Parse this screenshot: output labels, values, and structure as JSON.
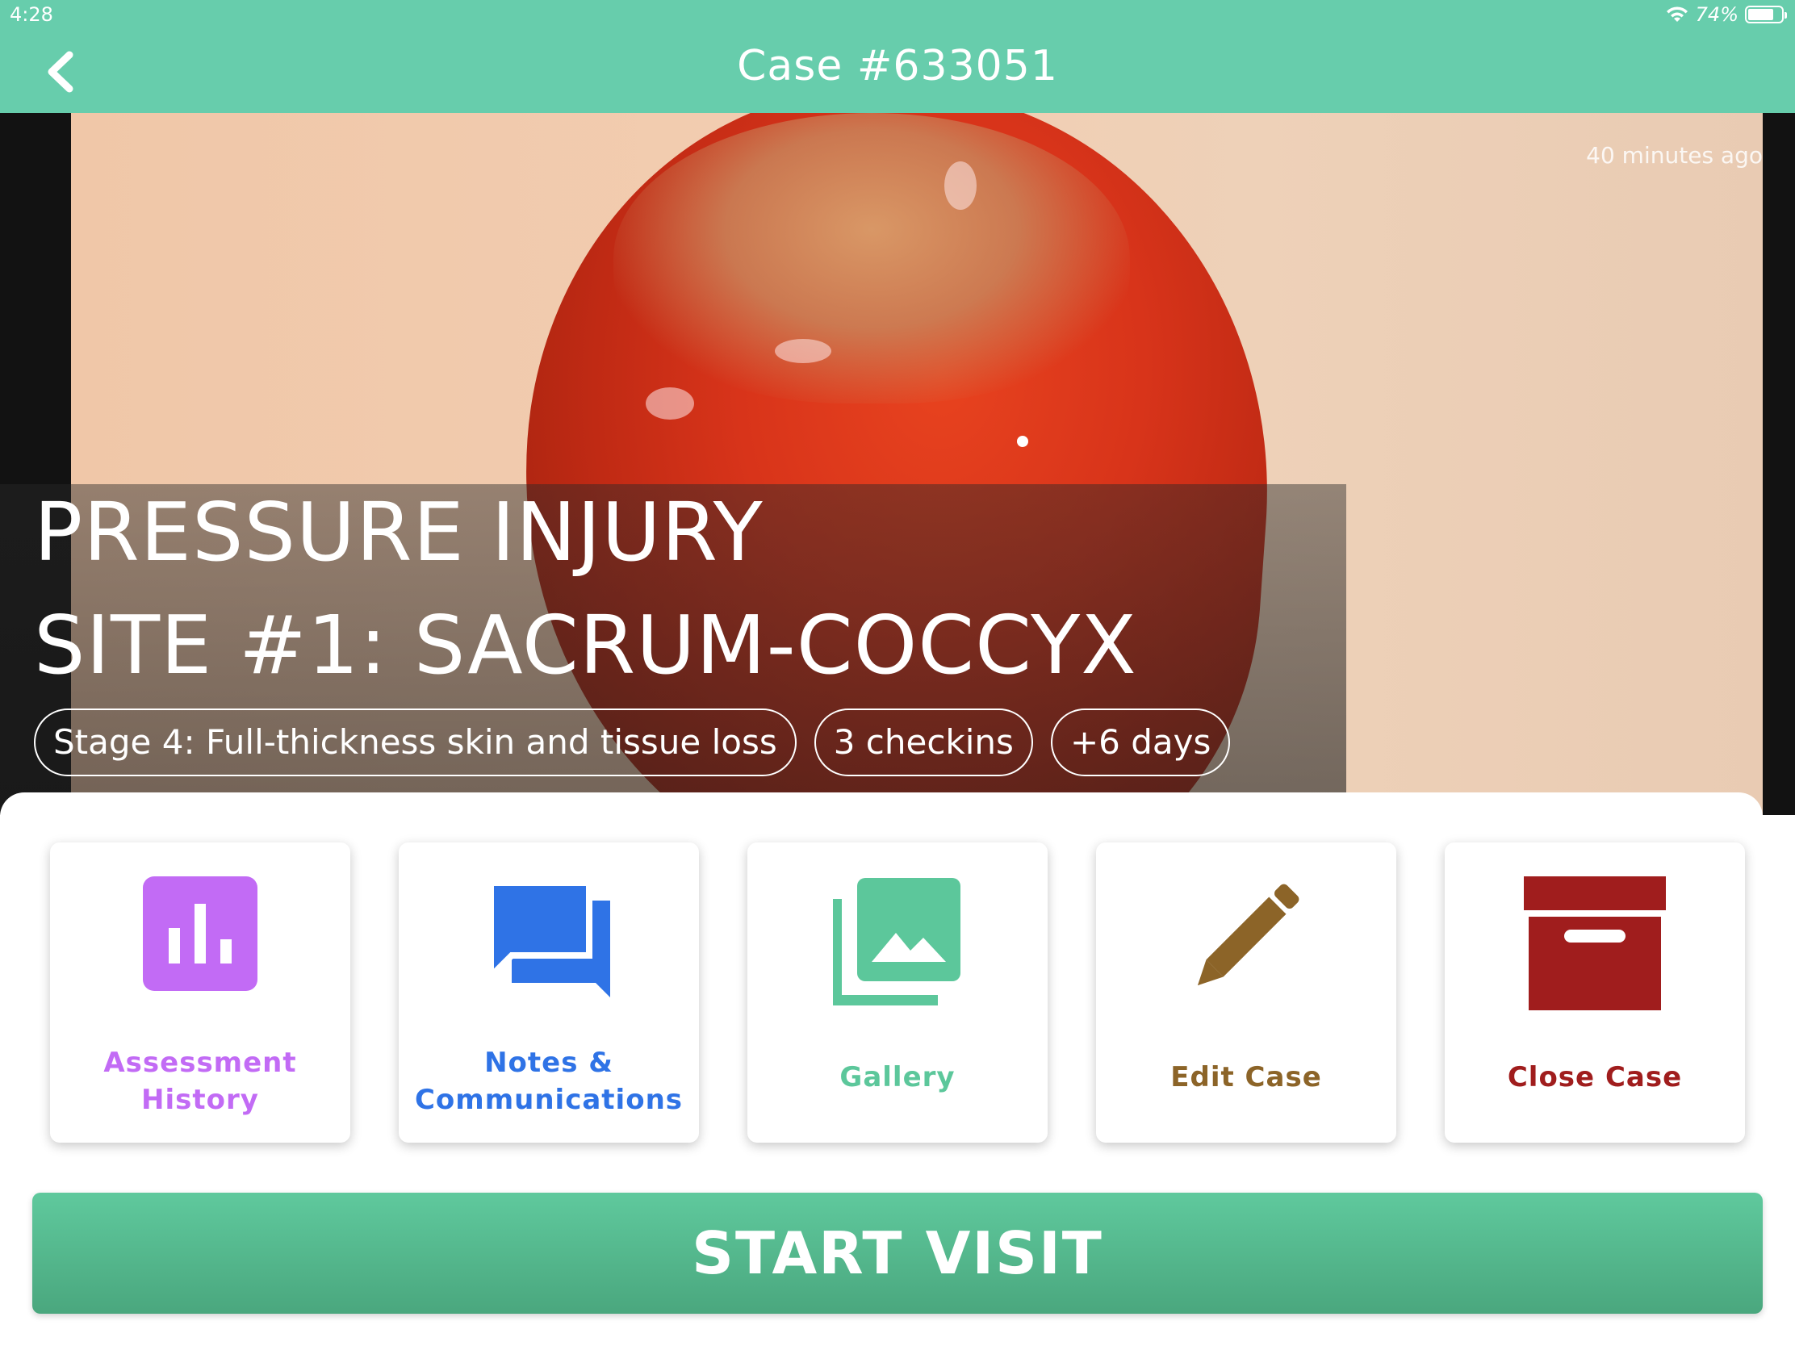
{
  "status_bar": {
    "time": "4:28",
    "battery": "74%",
    "battery_level": 0.74,
    "wifi_icon": "wifi-icon"
  },
  "nav": {
    "title": "Case #633051",
    "back_icon": "chevron-left-icon"
  },
  "hero": {
    "time_ago": "40 minutes ago",
    "title_line1": "PRESSURE INJURY",
    "title_line2": "SITE #1: SACRUM-COCCYX",
    "chips": [
      "Stage 4: Full-thickness skin and tissue loss",
      "3 checkins",
      "+6 days"
    ]
  },
  "actions": [
    {
      "line1": "Assessment",
      "line2": "History",
      "icon": "bar-chart-icon",
      "color": "#c26bf5"
    },
    {
      "line1": "Notes  &",
      "line2": "Communications",
      "icon": "chat-bubbles-icon",
      "color": "#2f73e6"
    },
    {
      "label": "Gallery",
      "icon": "photo-gallery-icon",
      "color": "#5cc79b"
    },
    {
      "label": "Edit  Case",
      "icon": "pencil-icon",
      "color": "#8c6428"
    },
    {
      "label": "Close  Case",
      "icon": "archive-box-icon",
      "color": "#a01d1d"
    }
  ],
  "start_button": {
    "label": "START VISIT"
  },
  "colors": {
    "header": "#67cdac",
    "start_button": "#55b98f"
  }
}
